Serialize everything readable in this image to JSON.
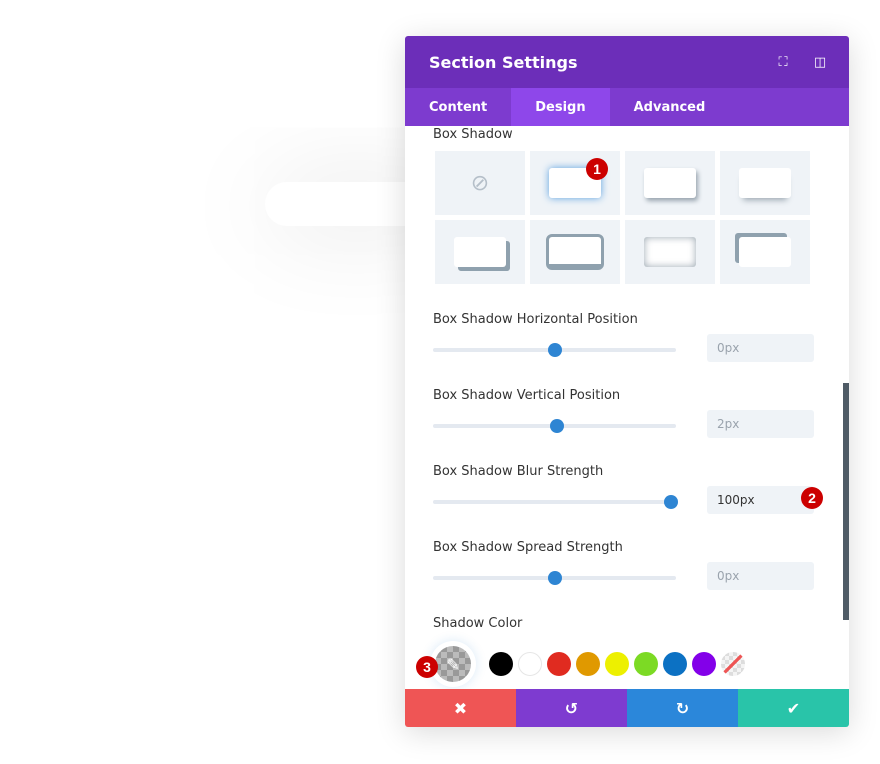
{
  "panel": {
    "title": "Section Settings",
    "header_icons": [
      "fullscreen-icon",
      "sidebar-toggle-icon"
    ]
  },
  "tabs": [
    {
      "label": "Content",
      "active": false
    },
    {
      "label": "Design",
      "active": true
    },
    {
      "label": "Advanced",
      "active": false
    }
  ],
  "box_shadow": {
    "label": "Box Shadow",
    "presets": [
      "none",
      "glow",
      "bottom-right",
      "bottom",
      "offset-corner",
      "border-bottom",
      "inset",
      "top-left-border"
    ],
    "selected": 1
  },
  "sliders": [
    {
      "label": "Box Shadow Horizontal Position",
      "value": "0px",
      "fraction": 0.5
    },
    {
      "label": "Box Shadow Vertical Position",
      "value": "2px",
      "fraction": 0.51
    },
    {
      "label": "Box Shadow Blur Strength",
      "value": "100px",
      "fraction": 0.98
    },
    {
      "label": "Box Shadow Spread Strength",
      "value": "0px",
      "fraction": 0.5
    }
  ],
  "shadow_color": {
    "label": "Shadow Color",
    "swatches": [
      "#000000",
      "#ffffff",
      "#e02b20",
      "#e09900",
      "#edf000",
      "#7cda24",
      "#0c71c3",
      "#8300e9"
    ]
  },
  "badges": [
    "1",
    "2",
    "3"
  ],
  "footer": {
    "colors": {
      "cancel": "#ef5555",
      "undo": "#7e3bd0",
      "redo": "#2b87da",
      "save": "#29c4a9"
    }
  }
}
